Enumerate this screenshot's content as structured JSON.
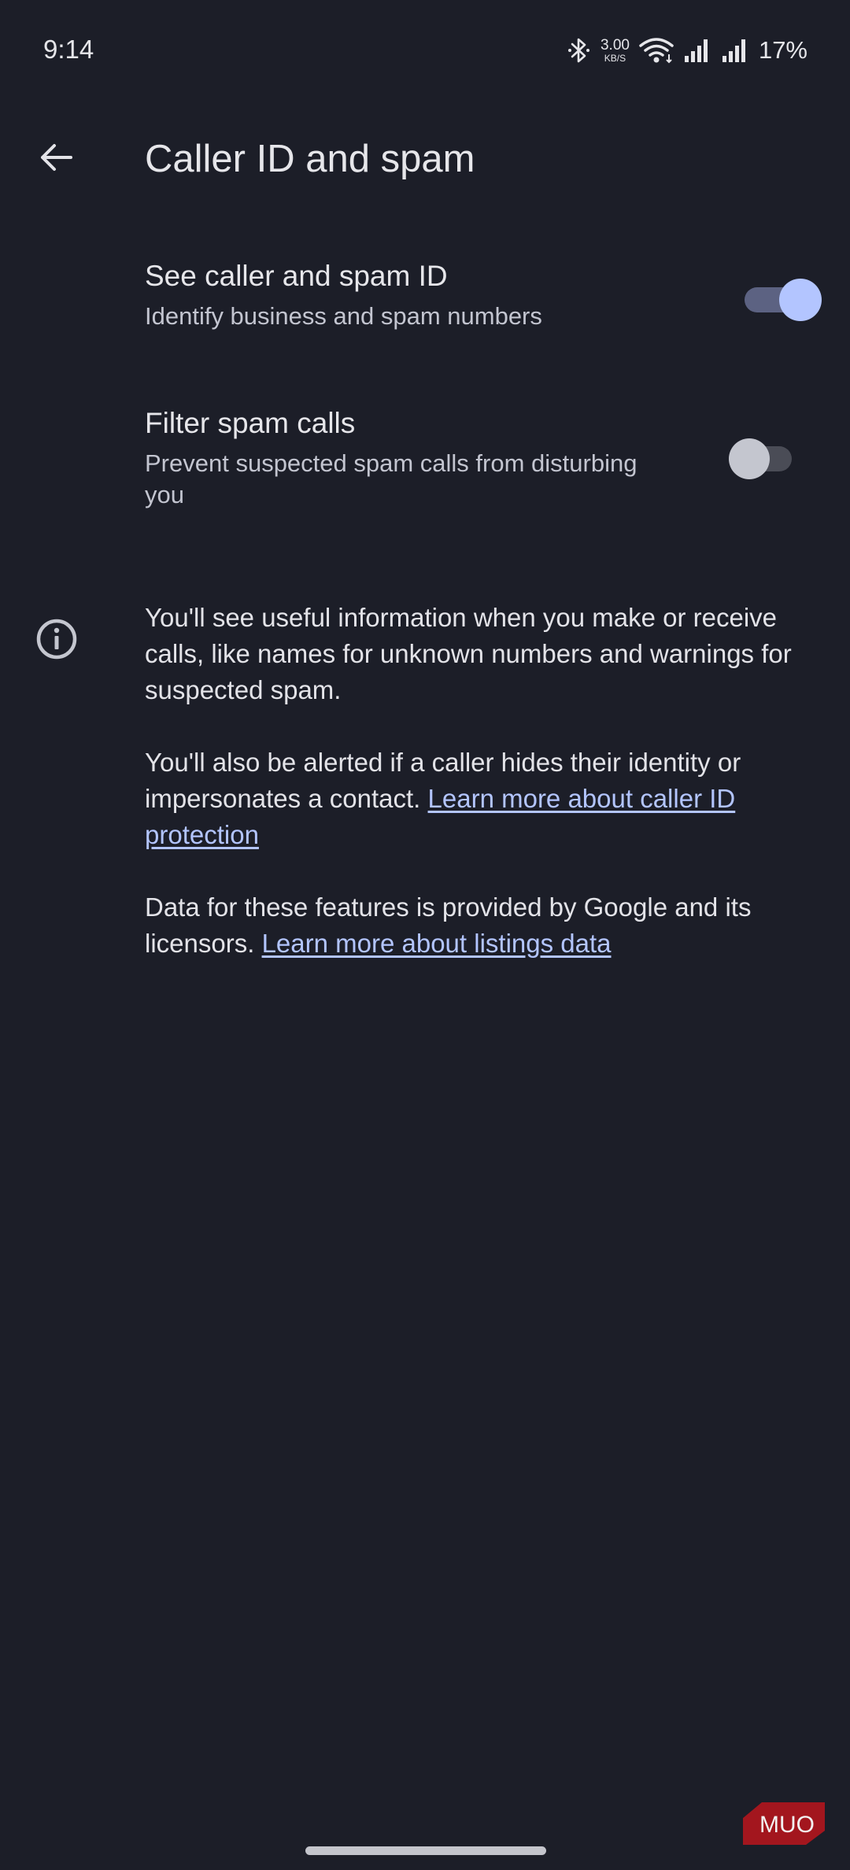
{
  "status_bar": {
    "time": "9:14",
    "network_speed_value": "3.00",
    "network_speed_unit": "KB/S",
    "battery_percent": "17%",
    "icons": [
      "bluetooth-icon",
      "wifi-icon",
      "signal-icon",
      "signal-icon",
      "battery-percent"
    ]
  },
  "app_bar": {
    "back_icon": "arrow-back-icon",
    "title": "Caller ID and spam"
  },
  "settings": [
    {
      "title": "See caller and spam ID",
      "summary": "Identify business and spam numbers",
      "enabled": true
    },
    {
      "title": "Filter spam calls",
      "summary": "Prevent suspected spam calls from disturbing you",
      "enabled": false
    }
  ],
  "info": {
    "icon": "info-icon",
    "paragraph1": "You'll see useful information when you make or receive calls, like names for unknown numbers and warnings for suspected spam.",
    "paragraph2_text": "You'll also be alerted if a caller hides their identity or impersonates a contact. ",
    "paragraph2_link": "Learn more about caller ID protection",
    "paragraph3_text": "Data for these features is provided by Google and its licensors. ",
    "paragraph3_link": "Learn more about listings data"
  },
  "watermark": {
    "text": "MUO"
  },
  "colors": {
    "background": "#1c1e28",
    "accent": "#b3c5ff",
    "text_primary": "#e6e6ea",
    "text_secondary": "#c3c5d0"
  }
}
